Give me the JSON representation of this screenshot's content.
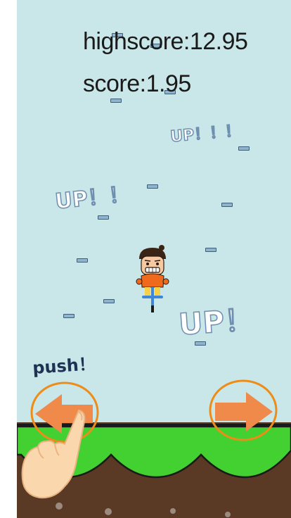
{
  "hud": {
    "highscore": "highscore:12.95",
    "score": "score:1.95"
  },
  "floaters": [
    "UP！！！",
    "UP！！",
    "UP！"
  ],
  "hint": "push！",
  "controls": {
    "left": "left-arrow-icon",
    "right": "right-arrow-icon"
  },
  "colors": {
    "sky": "#c9e6e8",
    "grass": "#43d132",
    "soil": "#5a3a24",
    "button": "#ef8a4a",
    "ring": "#ee8c18"
  }
}
